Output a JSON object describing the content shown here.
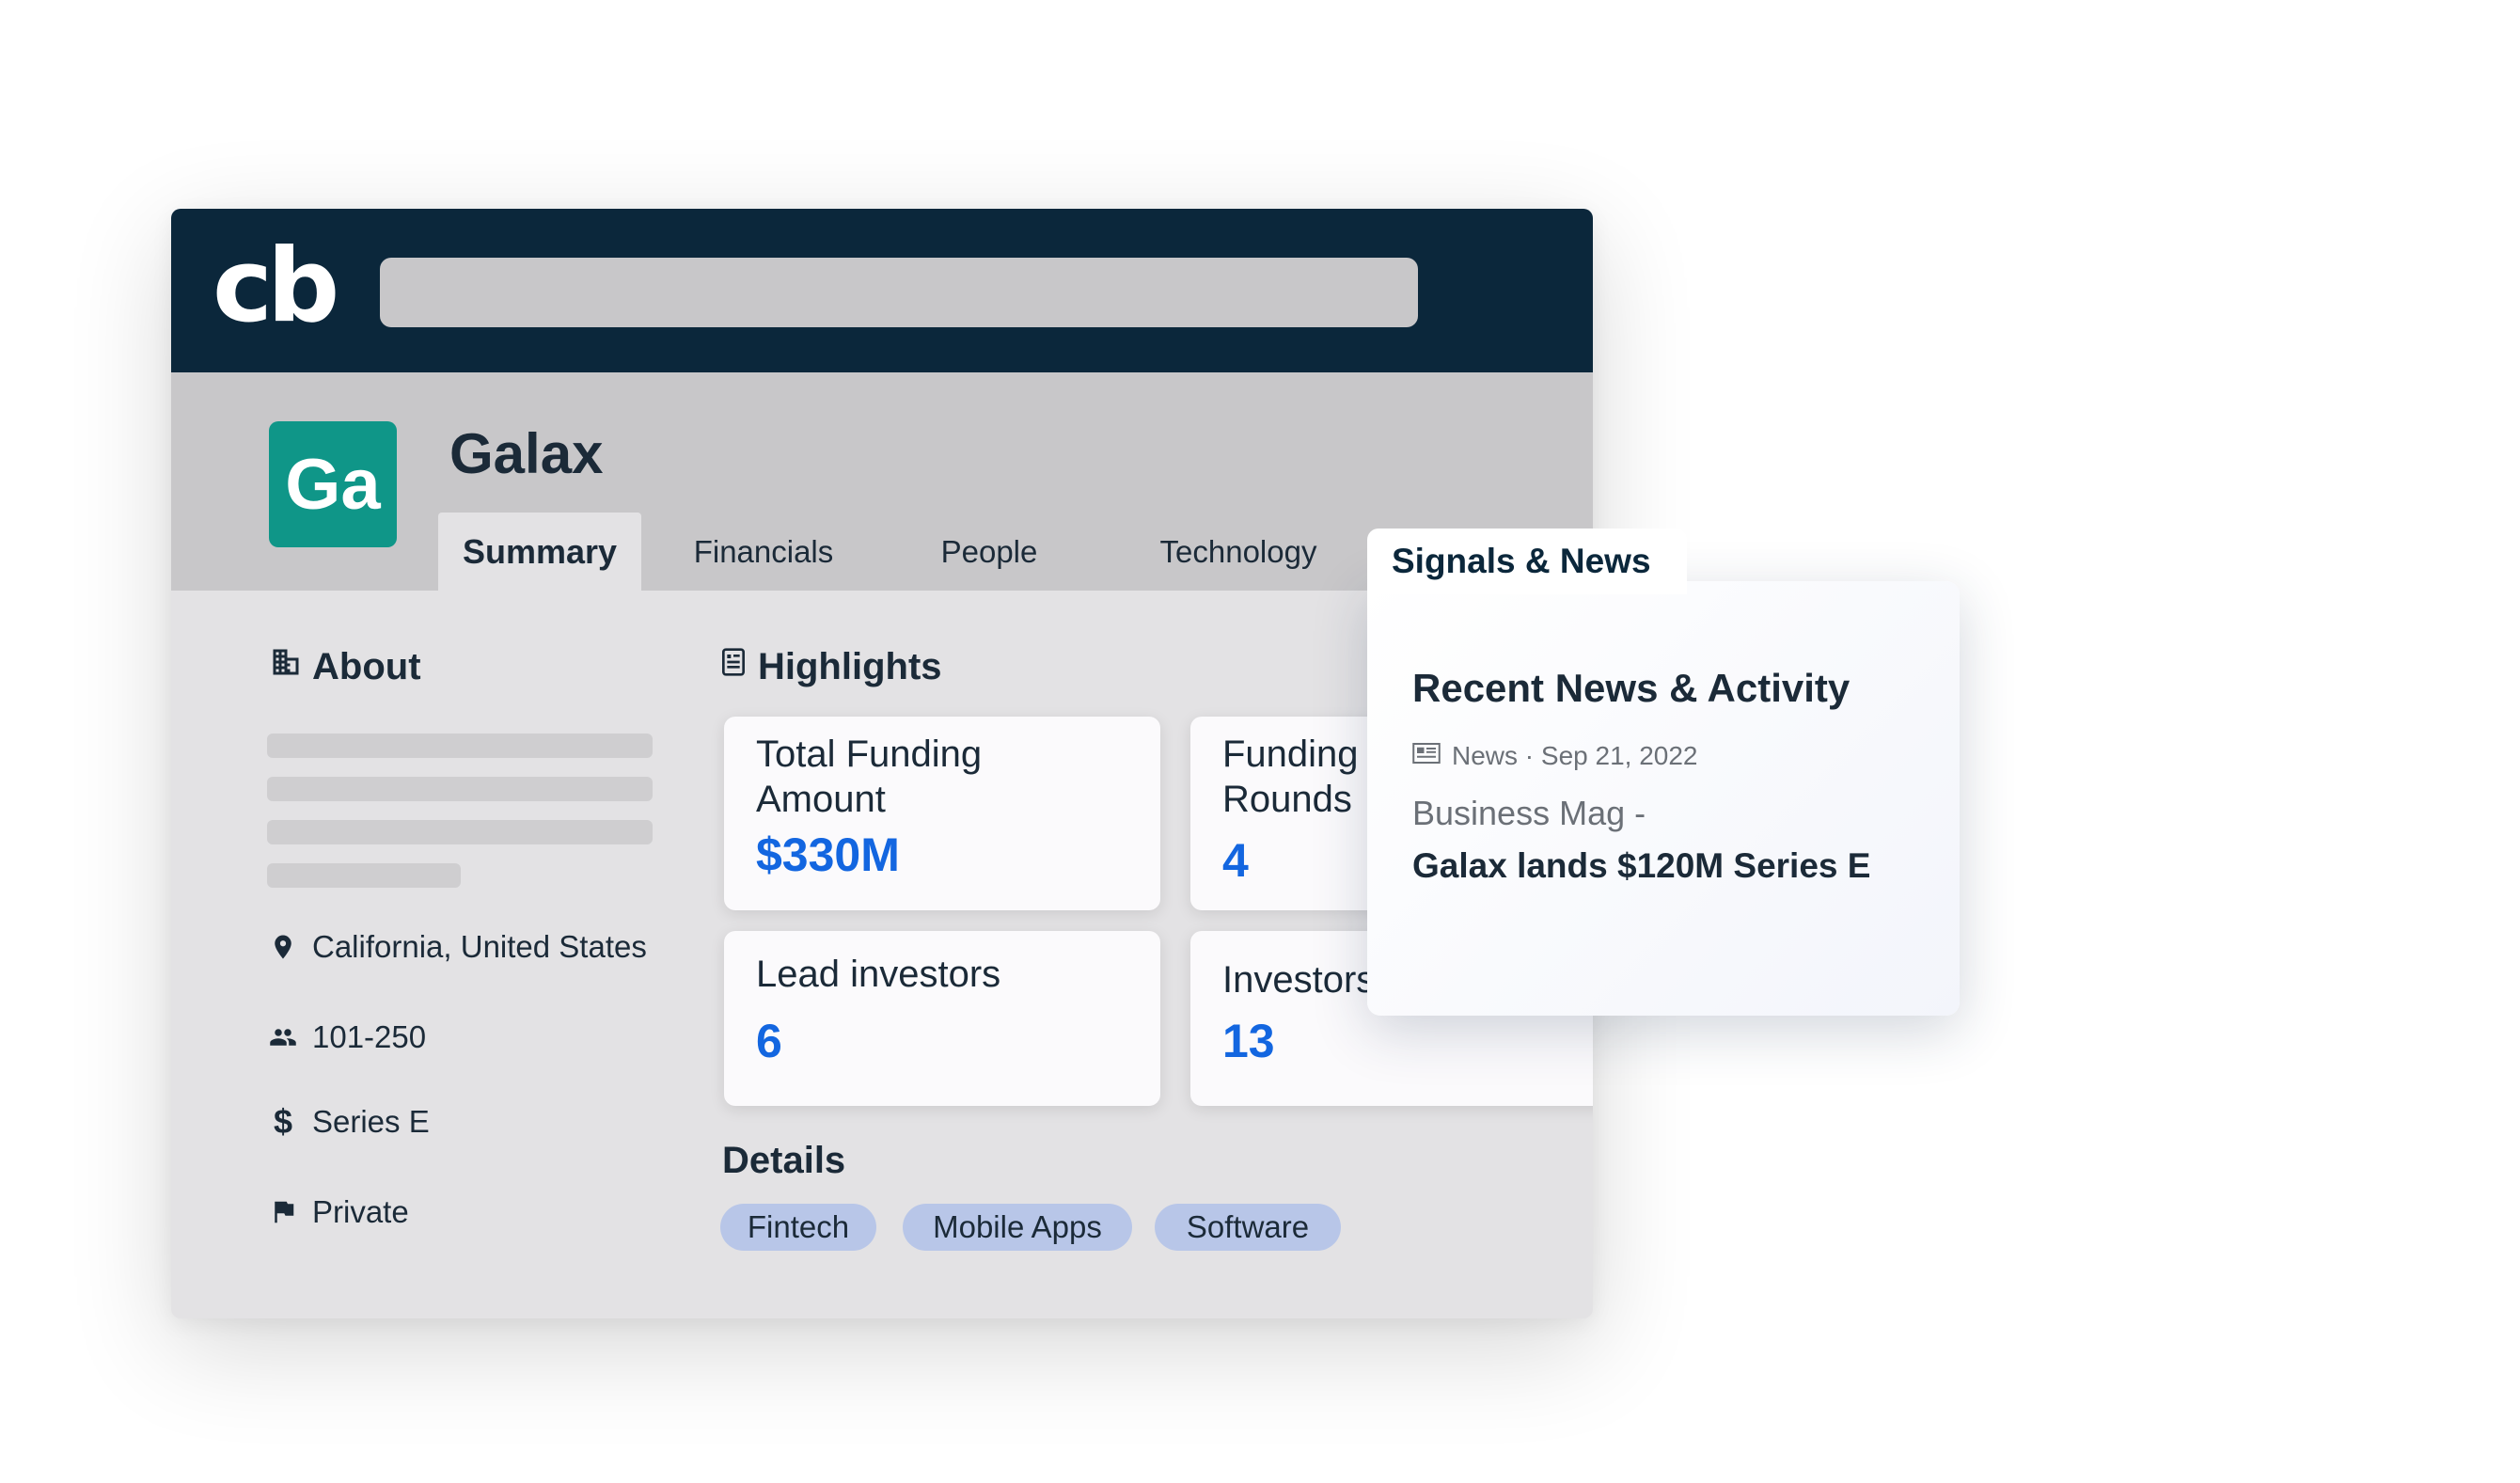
{
  "app": {
    "logo_text": "cb"
  },
  "company": {
    "logo_initials": "Ga",
    "name": "Galax"
  },
  "tabs": [
    {
      "label": "Summary",
      "active": true
    },
    {
      "label": "Financials"
    },
    {
      "label": "People"
    },
    {
      "label": "Technology"
    }
  ],
  "about": {
    "title": "About",
    "location": "California, United States",
    "employees": "101-250",
    "funding_stage": "Series E",
    "status": "Private"
  },
  "highlights": {
    "title": "Highlights",
    "cards": [
      {
        "label": "Total Funding Amount",
        "value": "$330M"
      },
      {
        "label": "Funding Rounds",
        "value": "4"
      },
      {
        "label": "Lead investors",
        "value": "6"
      },
      {
        "label": "Investors",
        "value": "13"
      }
    ]
  },
  "details": {
    "title": "Details",
    "tags": [
      "Fintech",
      "Mobile Apps",
      "Software"
    ]
  },
  "news": {
    "tab_label": "Signals & News",
    "heading": "Recent News & Activity",
    "meta": "News · Sep 21, 2022",
    "source": "Business Mag -",
    "headline": "Galax lands  $120M Series E"
  },
  "colors": {
    "topbar": "#0b273b",
    "accent_value": "#1366e0",
    "company_logo": "#0f9688",
    "tag_chip": "#b8c6e8"
  }
}
